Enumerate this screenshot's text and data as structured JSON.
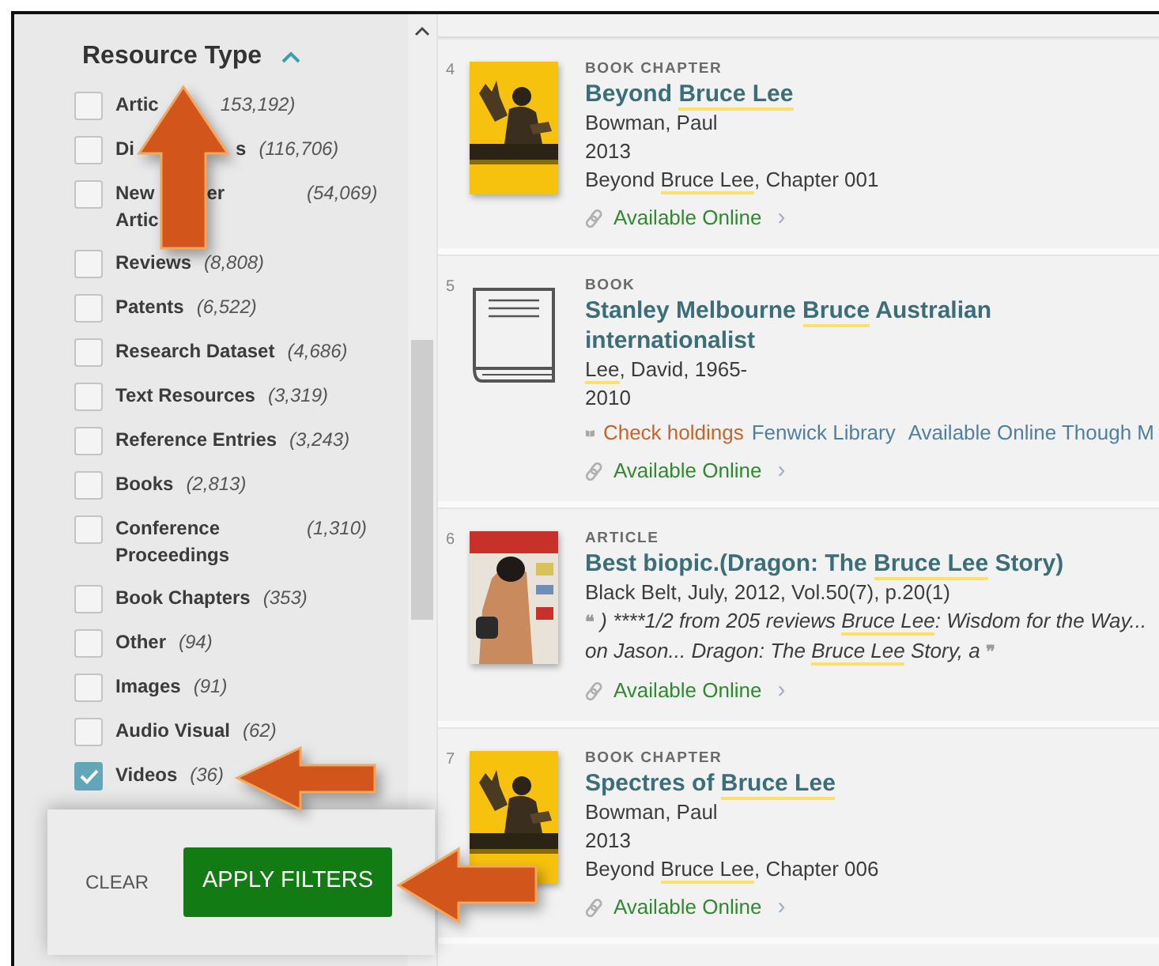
{
  "filter": {
    "heading": "Resource Type",
    "expanded": true,
    "items": [
      {
        "label": "Artic",
        "count": "153,192)",
        "checked": false,
        "covered": true
      },
      {
        "label": "Di",
        "label_tail": "s",
        "count": "(116,706)",
        "checked": false,
        "covered": true
      },
      {
        "label": "New",
        "label_tail": "er",
        "label_line2": "Artic",
        "count": "(54,069)",
        "checked": false,
        "covered": true
      },
      {
        "label": "Reviews",
        "count": "(8,808)",
        "checked": false
      },
      {
        "label": "Patents",
        "count": "(6,522)",
        "checked": false
      },
      {
        "label": "Research Dataset",
        "count": "(4,686)",
        "checked": false
      },
      {
        "label": "Text Resources",
        "count": "(3,319)",
        "checked": false
      },
      {
        "label": "Reference Entries",
        "count": "(3,243)",
        "checked": false
      },
      {
        "label": "Books",
        "count": "(2,813)",
        "checked": false
      },
      {
        "label": "Conference Proceedings",
        "count": "(1,310)",
        "checked": false
      },
      {
        "label": "Book Chapters",
        "count": "(353)",
        "checked": false
      },
      {
        "label": "Other",
        "count": "(94)",
        "checked": false
      },
      {
        "label": "Images",
        "count": "(91)",
        "checked": false
      },
      {
        "label": "Audio Visual",
        "count": "(62)",
        "checked": false
      },
      {
        "label": "Videos",
        "count": "(36)",
        "checked": true
      }
    ],
    "clear": "CLEAR",
    "apply": "APPLY FILTERS"
  },
  "results": [
    {
      "number": "4",
      "type": "BOOK CHAPTER",
      "cover": {
        "kind": "picture"
      },
      "title": [
        {
          "text": "Beyond "
        },
        {
          "text": "Bruce Lee",
          "highlight": true
        }
      ],
      "lines": [
        {
          "kind": "text",
          "parts": [
            {
              "text": "Bowman, Paul"
            }
          ]
        },
        {
          "kind": "text",
          "parts": [
            {
              "text": "2013"
            }
          ]
        },
        {
          "kind": "text",
          "parts": [
            {
              "text": "Beyond "
            },
            {
              "text": "Bruce Lee",
              "highlight": true
            },
            {
              "text": ", Chapter 001"
            }
          ]
        }
      ],
      "availability": {
        "text": "Available Online",
        "chevron": "›"
      }
    },
    {
      "number": "5",
      "type": "BOOK",
      "cover": {
        "kind": "book"
      },
      "title": [
        {
          "text": "Stanley Melbourne "
        },
        {
          "text": "Bruce",
          "highlight": true
        },
        {
          "text": " Australian internationalist"
        }
      ],
      "lines": [
        {
          "kind": "text",
          "parts": [
            {
              "text": "Lee",
              "highlight": true
            },
            {
              "text": ", David, 1965-"
            }
          ]
        },
        {
          "kind": "text",
          "parts": [
            {
              "text": "2010"
            }
          ]
        },
        {
          "kind": "holdings",
          "parts": [
            {
              "text": "Check holdings",
              "kind": "status"
            },
            {
              "text": "Fenwick Library",
              "kind": "link"
            },
            {
              "text": "Available Online Though M",
              "kind": "link"
            }
          ]
        }
      ],
      "availability": {
        "text": "Available Online",
        "chevron": "›"
      }
    },
    {
      "number": "6",
      "type": "ARTICLE",
      "cover": {
        "kind": "magazine"
      },
      "title": [
        {
          "text": "Best biopic.(Dragon: The "
        },
        {
          "text": "Bruce Lee",
          "highlight": true
        },
        {
          "text": " Story)"
        }
      ],
      "lines": [
        {
          "kind": "text",
          "parts": [
            {
              "text": "Black Belt, July, 2012, Vol.50(7), p.20(1)"
            }
          ]
        },
        {
          "kind": "snippet",
          "open": "❝",
          "close": "❞",
          "parts": [
            {
              "text": ") ****1/2 from 205 reviews "
            },
            {
              "text": "Bruce Lee",
              "highlight": true
            },
            {
              "text": ": Wisdom for the Way... on Jason... Dragon: The "
            },
            {
              "text": "Bruce Lee",
              "highlight": true
            },
            {
              "text": " Story, a"
            }
          ]
        }
      ],
      "availability": {
        "text": "Available Online",
        "chevron": "›"
      }
    },
    {
      "number": "7",
      "type": "BOOK CHAPTER",
      "cover": {
        "kind": "picture"
      },
      "title": [
        {
          "text": "Spectres of "
        },
        {
          "text": "Bruce Lee",
          "highlight": true
        }
      ],
      "lines": [
        {
          "kind": "text",
          "parts": [
            {
              "text": "Bowman, Paul"
            }
          ]
        },
        {
          "kind": "text",
          "parts": [
            {
              "text": "2013"
            }
          ]
        },
        {
          "kind": "text",
          "parts": [
            {
              "text": "Beyond "
            },
            {
              "text": "Bruce Lee",
              "highlight": true
            },
            {
              "text": ", Chapter 006"
            }
          ]
        }
      ],
      "availability": {
        "text": "Available Online",
        "chevron": "›"
      }
    }
  ]
}
